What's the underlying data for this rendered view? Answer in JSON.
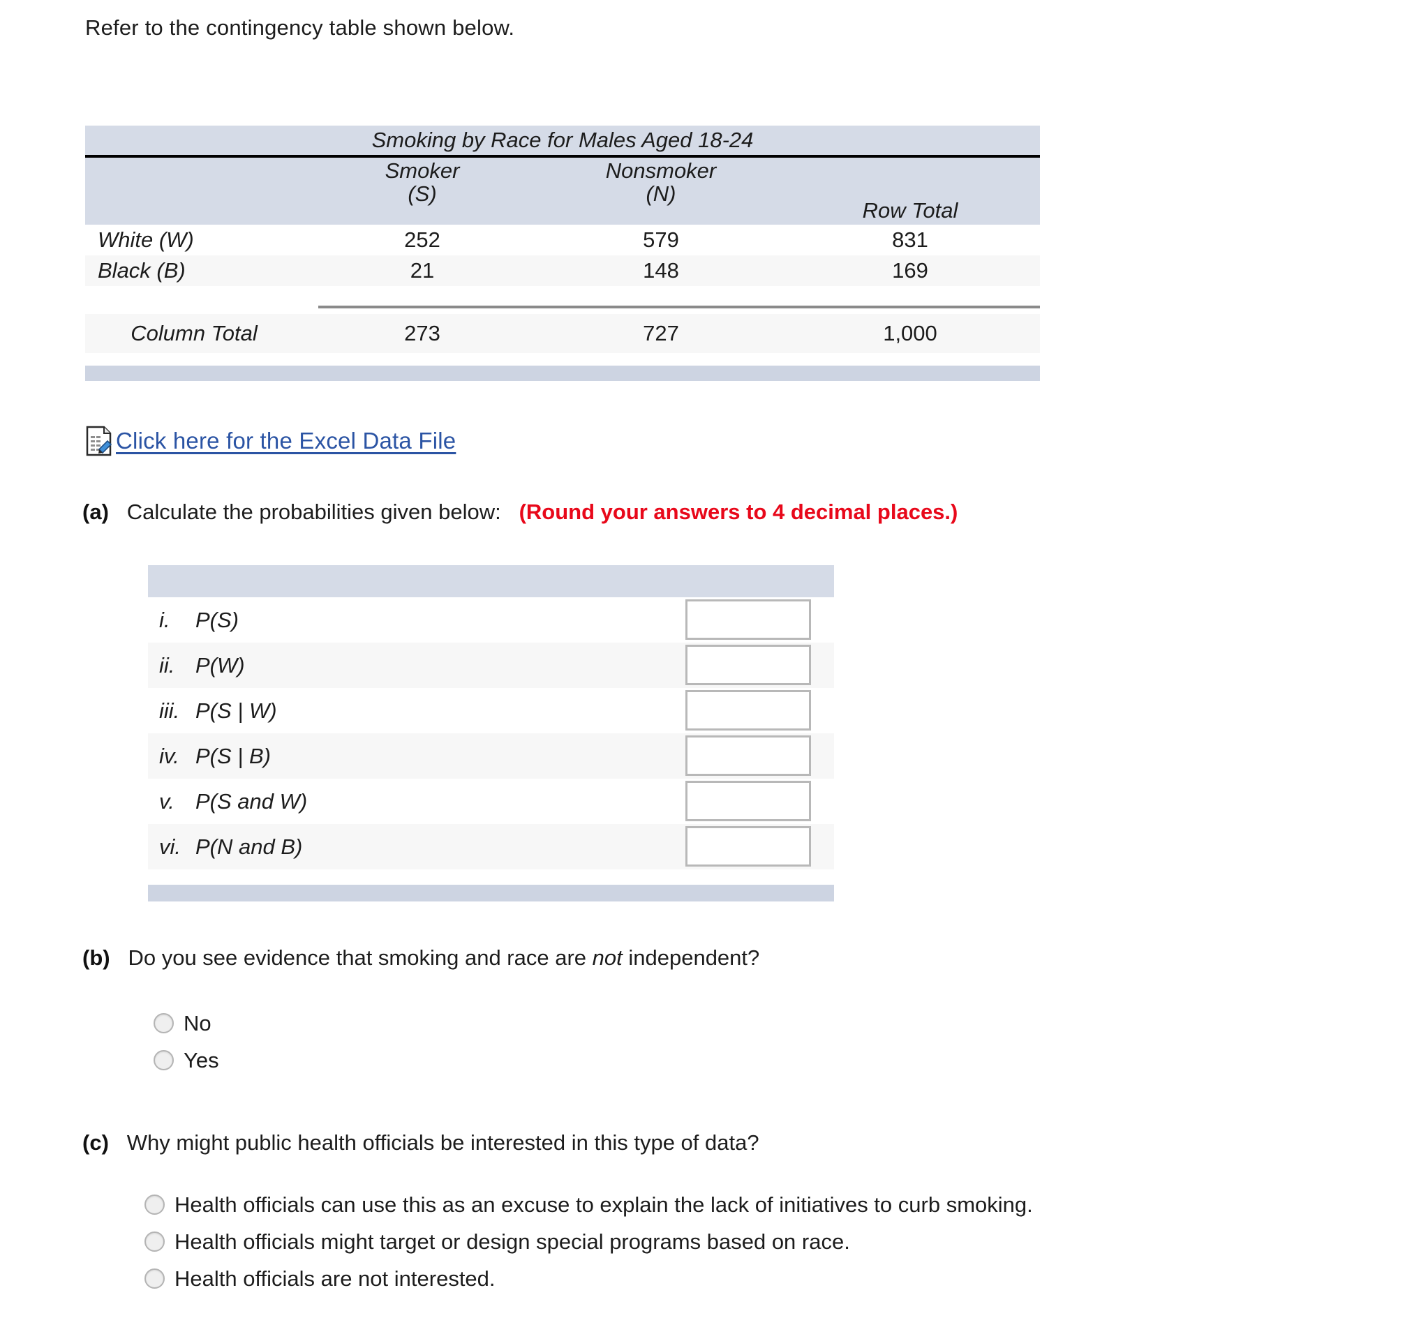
{
  "intro": "Refer to the contingency table shown below.",
  "contingency_table": {
    "title": "Smoking by Race for Males Aged 18-24",
    "columns": [
      {
        "line1": "Smoker",
        "line2": "(S)"
      },
      {
        "line1": "Nonsmoker",
        "line2": "(N)"
      },
      {
        "line1": "Row Total",
        "line2": ""
      }
    ],
    "rows": [
      {
        "label": "White (W)",
        "smoker": "252",
        "nonsmoker": "579",
        "row_total": "831"
      },
      {
        "label": "Black (B)",
        "smoker": "21",
        "nonsmoker": "148",
        "row_total": "169"
      }
    ],
    "total_row": {
      "label": "Column Total",
      "smoker": "273",
      "nonsmoker": "727",
      "row_total": "1,000"
    }
  },
  "excel_link": {
    "icon": "spreadsheet-document-icon",
    "text": "Click here for the Excel Data File"
  },
  "parts": {
    "a": {
      "marker": "(a)",
      "prompt": "Calculate the probabilities given below:",
      "note": "(Round your answers to 4 decimal places.)",
      "items": [
        {
          "numeral": "i.",
          "expr": "P(S)",
          "value": ""
        },
        {
          "numeral": "ii.",
          "expr": "P(W)",
          "value": ""
        },
        {
          "numeral": "iii.",
          "expr": "P(S | W)",
          "value": ""
        },
        {
          "numeral": "iv.",
          "expr": "P(S | B)",
          "value": ""
        },
        {
          "numeral": "v.",
          "expr": "P(S and W)",
          "value": ""
        },
        {
          "numeral": "vi.",
          "expr": "P(N and B)",
          "value": ""
        }
      ]
    },
    "b": {
      "marker": "(b)",
      "prompt_before": "Do you see evidence that smoking and race are ",
      "prompt_italic": "not",
      "prompt_after": " independent?",
      "options": [
        {
          "label": "No",
          "selected": false
        },
        {
          "label": "Yes",
          "selected": false
        }
      ]
    },
    "c": {
      "marker": "(c)",
      "prompt": "Why might public health officials be interested in this type of data?",
      "options": [
        {
          "label": "Health officials can use this as an excuse to explain the lack of initiatives to curb smoking.",
          "selected": false
        },
        {
          "label": "Health officials might target or design special programs based on race.",
          "selected": false
        },
        {
          "label": "Health officials are not interested.",
          "selected": false
        }
      ]
    }
  },
  "colors": {
    "band": "#d5dbe7",
    "band_footer": "#cdd4e2",
    "link": "#2b54a4",
    "note_red": "#e8081a",
    "stripe": "#f7f7f7"
  }
}
